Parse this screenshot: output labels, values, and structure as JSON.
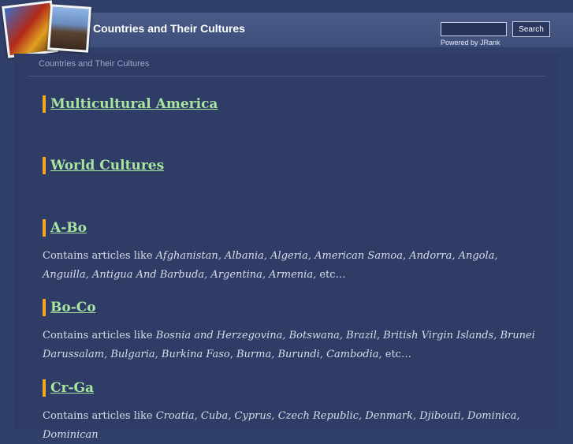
{
  "header": {
    "site_title": "Countries and Their Cultures",
    "search_button": "Search",
    "search_placeholder": "",
    "powered_by": "Powered by JRank"
  },
  "breadcrumb": "Countries and Their Cultures",
  "sections": [
    {
      "title": "Multicultural America"
    },
    {
      "title": "World Cultures"
    },
    {
      "title": "A-Bo",
      "prefix": "Contains articles like ",
      "items": "Afghanistan, Albania, Algeria, American Samoa, Andorra, Angola, Anguilla, Antigua And Barbuda, Argentina, Armenia,",
      "suffix": " etc…"
    },
    {
      "title": "Bo-Co",
      "prefix": "Contains articles like ",
      "items": "Bosnia and Herzegovina, Botswana, Brazil, British Virgin Islands, Brunei Darussalam, Bulgaria, Burkina Faso, Burma, Burundi, Cambodia,",
      "suffix": " etc…"
    },
    {
      "title": "Cr-Ga",
      "prefix": "Contains articles like ",
      "items": "Croatia, Cuba, Cyprus, Czech Republic, Denmark, Djibouti, Dominica, Dominican"
    }
  ],
  "colors": {
    "background": "#31406a",
    "link": "#a8e6a0",
    "accent_bar": "#f5a623",
    "text": "#d8dde8"
  }
}
